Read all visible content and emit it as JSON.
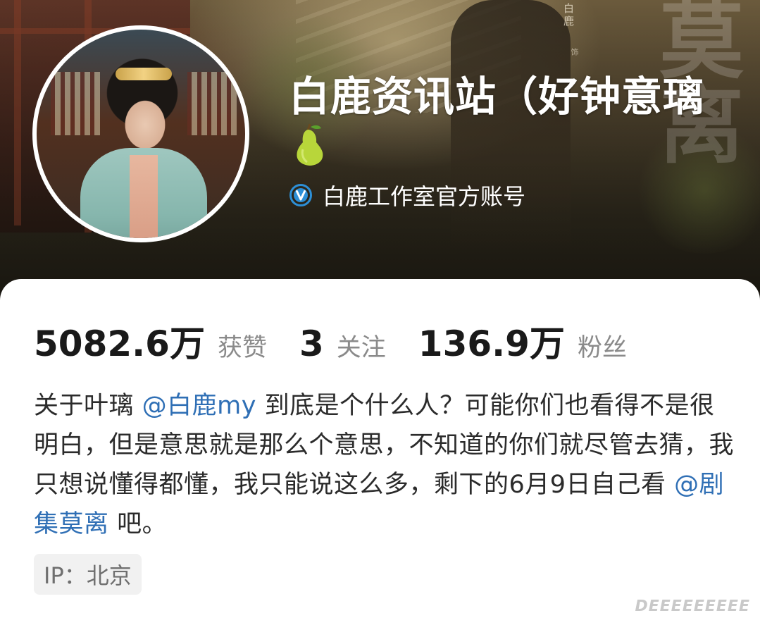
{
  "header": {
    "calligraphy_title": "莫离",
    "actor_credit": "白鹿",
    "actor_credit_role": "饰"
  },
  "profile": {
    "name": "白鹿资讯站（好钟意璃",
    "name_emoji_icon": "pear-icon",
    "verified_icon": "verified-v-icon",
    "verified_text": "白鹿工作室官方账号"
  },
  "stats": {
    "likes_value": "5082.6万",
    "likes_label": "获赞",
    "following_value": "3",
    "following_label": "关注",
    "followers_value": "136.9万",
    "followers_label": "粉丝"
  },
  "bio": {
    "part1": "关于叶璃 ",
    "mention1": "@白鹿my",
    "part2": " 到底是个什么人？可能你们也看得不是很明白，但是意思就是那么个意思，不知道的你们就尽管去猜，我只想说懂得都懂，我只能说这么多，剩下的6月9日自己看 ",
    "mention2": "@剧集莫离",
    "part3": " 吧。"
  },
  "ip": {
    "text": "IP：北京"
  },
  "watermark": {
    "text": "𝘿𝙀𝙀𝙀𝙀𝙀𝙀𝙀𝙀𝙀"
  },
  "colors": {
    "mention": "#2f6fb5",
    "verified": "#2d8fd6",
    "card_bg": "#ffffff"
  }
}
